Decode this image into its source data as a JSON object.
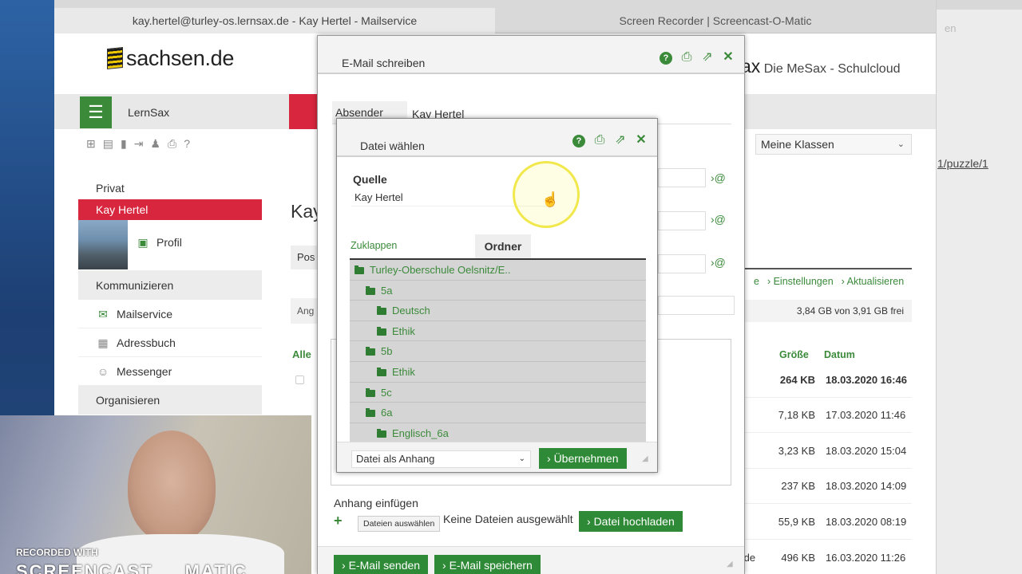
{
  "tabs": [
    {
      "label": "kay.hertel@turley-os.lernsax.de - Kay Hertel - Mailservice"
    },
    {
      "label": "Screen Recorder | Screencast-O-Matic"
    }
  ],
  "right_window": {
    "new_tab_symbol": "+",
    "partial_text": "en"
  },
  "site": {
    "logo_text": "sachsen.de",
    "brand_suffix": "ax",
    "brand_tagline": "Die MeSax - Schulcloud"
  },
  "nav": {
    "menu_icon": "☰",
    "label": "LernSax"
  },
  "sidebar": {
    "head": "Privat",
    "active_user": "Kay Hertel",
    "profile_link": "Profil",
    "section1": "Kommunizieren",
    "items": [
      {
        "label": "Mailservice",
        "icon": "mail-icon"
      },
      {
        "label": "Adressbuch",
        "icon": "addressbook-icon"
      },
      {
        "label": "Messenger",
        "icon": "messenger-icon"
      }
    ],
    "section2": "Organisieren"
  },
  "main": {
    "title_partial": "Kay",
    "pos_partial": "Pos",
    "ang_partial": "Ang",
    "alle": "Alle",
    "classes_select": "Meine Klassen",
    "puzzle_link": "1/puzzle/1",
    "actions": [
      "e",
      "› Einstellungen",
      "› Aktualisieren"
    ],
    "storage": "3,84 GB von 3,91 GB frei",
    "col_size": "Größe",
    "col_date": "Datum",
    "files": [
      {
        "size": "264 KB",
        "date": "18.03.2020 16:46",
        "bold": true
      },
      {
        "size": "7,18 KB",
        "date": "17.03.2020 11:46",
        "bold": false
      },
      {
        "size": "3,23 KB",
        "date": "18.03.2020 15:04",
        "bold": false
      },
      {
        "size": "237 KB",
        "date": "18.03.2020 14:09",
        "bold": false
      },
      {
        "size": "55,9 KB",
        "date": "18.03.2020 08:19",
        "bold": false
      },
      {
        "size": "496 KB",
        "date": "16.03.2020 11:26",
        "bold": false
      }
    ],
    "email_suffix": ".de"
  },
  "compose": {
    "title": "E-Mail schreiben",
    "help": "?",
    "sender_label": "Absender",
    "sender_value": "Kay Hertel",
    "at_symbol": "›@",
    "attach_title": "Anhang einfügen",
    "plus": "+",
    "choose_files": "Dateien auswählen",
    "no_files": "Keine Dateien ausgewählt",
    "upload_btn": "Datei hochladen",
    "send_btn": "E-Mail senden",
    "save_btn": "E-Mail speichern"
  },
  "file_dialog": {
    "title": "Datei wählen",
    "help": "?",
    "source_label": "Quelle",
    "source_value": "Kay Hertel",
    "collapse": "Zuklappen",
    "folder_tab": "Ordner",
    "tree": [
      {
        "label": "Turley-Oberschule Oelsnitz/E..",
        "level": 0
      },
      {
        "label": "5a",
        "level": 1
      },
      {
        "label": "Deutsch",
        "level": 2
      },
      {
        "label": "Ethik",
        "level": 2
      },
      {
        "label": "5b",
        "level": 1
      },
      {
        "label": "Ethik",
        "level": 2
      },
      {
        "label": "5c",
        "level": 1
      },
      {
        "label": "6a",
        "level": 1
      },
      {
        "label": "Englisch_6a",
        "level": 2
      }
    ],
    "mode_select": "Datei als Anhang",
    "apply_btn": "Übernehmen"
  },
  "watermark": {
    "line1": "RECORDED WITH",
    "line2": "SCREENCAST",
    "line3": "MATIC"
  },
  "colors": {
    "accent_green": "#2e8a36",
    "brand_red": "#d7263d"
  }
}
